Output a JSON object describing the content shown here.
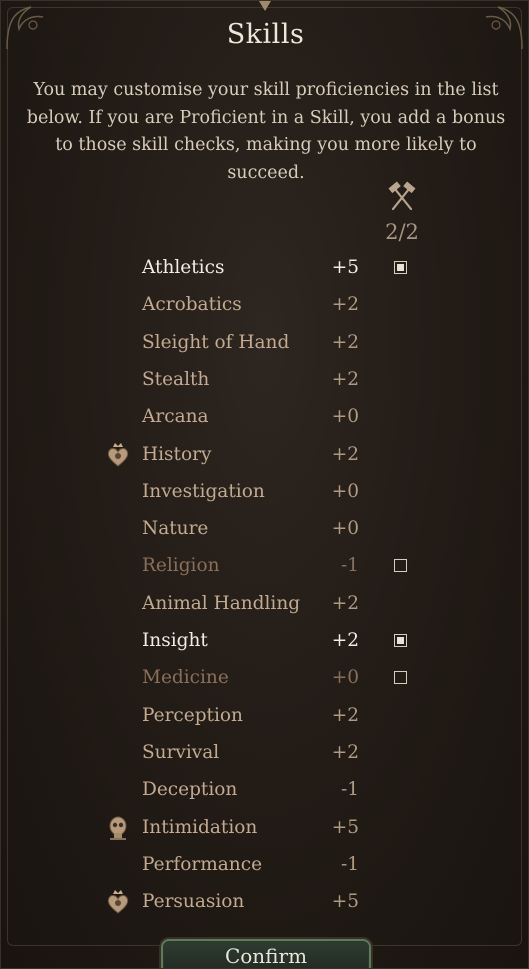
{
  "dialog": {
    "title": "Skills",
    "description": "You may customise your skill proficiencies in the list below. If you are Proficient in a Skill, you add a bonus to those skill checks, making you more likely to succeed.",
    "proficiency_counter": "2/2",
    "counter_icon": "crossed-hammers-icon",
    "confirm_label": "Confirm"
  },
  "skills": [
    {
      "name": "Athletics",
      "bonus": "+5",
      "state": "selected",
      "checkbox": "checked",
      "source_icon": null
    },
    {
      "name": "Acrobatics",
      "bonus": "+2",
      "state": "normal",
      "checkbox": null,
      "source_icon": null
    },
    {
      "name": "Sleight of Hand",
      "bonus": "+2",
      "state": "normal",
      "checkbox": null,
      "source_icon": null
    },
    {
      "name": "Stealth",
      "bonus": "+2",
      "state": "normal",
      "checkbox": null,
      "source_icon": null
    },
    {
      "name": "Arcana",
      "bonus": "+0",
      "state": "normal",
      "checkbox": null,
      "source_icon": null
    },
    {
      "name": "History",
      "bonus": "+2",
      "state": "normal",
      "checkbox": null,
      "source_icon": "heart-crown-icon"
    },
    {
      "name": "Investigation",
      "bonus": "+0",
      "state": "normal",
      "checkbox": null,
      "source_icon": null
    },
    {
      "name": "Nature",
      "bonus": "+0",
      "state": "normal",
      "checkbox": null,
      "source_icon": null
    },
    {
      "name": "Religion",
      "bonus": "-1",
      "state": "muted",
      "checkbox": "unchecked",
      "source_icon": null
    },
    {
      "name": "Animal Handling",
      "bonus": "+2",
      "state": "normal",
      "checkbox": null,
      "source_icon": null
    },
    {
      "name": "Insight",
      "bonus": "+2",
      "state": "selected",
      "checkbox": "checked",
      "source_icon": null
    },
    {
      "name": "Medicine",
      "bonus": "+0",
      "state": "muted",
      "checkbox": "unchecked",
      "source_icon": null
    },
    {
      "name": "Perception",
      "bonus": "+2",
      "state": "normal",
      "checkbox": null,
      "source_icon": null
    },
    {
      "name": "Survival",
      "bonus": "+2",
      "state": "normal",
      "checkbox": null,
      "source_icon": null
    },
    {
      "name": "Deception",
      "bonus": "-1",
      "state": "normal",
      "checkbox": null,
      "source_icon": null
    },
    {
      "name": "Intimidation",
      "bonus": "+5",
      "state": "normal",
      "checkbox": null,
      "source_icon": "skull-emblem-icon"
    },
    {
      "name": "Performance",
      "bonus": "-1",
      "state": "normal",
      "checkbox": null,
      "source_icon": null
    },
    {
      "name": "Persuasion",
      "bonus": "+5",
      "state": "normal",
      "checkbox": null,
      "source_icon": "heart-crown-icon"
    }
  ],
  "colors": {
    "background": "#231c17",
    "text_primary": "#f2ece2",
    "text_normal": "#c3aa90",
    "text_muted": "#8a6f5a",
    "confirm_border": "#5e7a5e"
  }
}
